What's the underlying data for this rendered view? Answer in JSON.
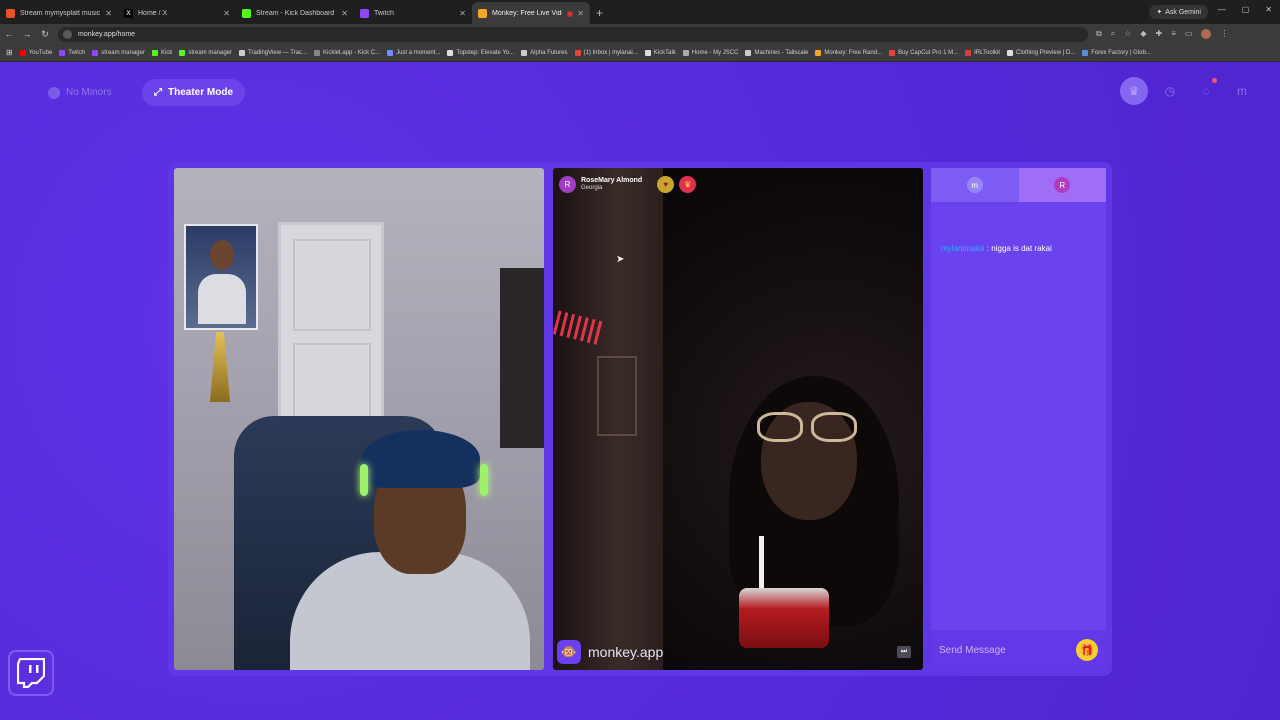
{
  "browser": {
    "tabs": [
      {
        "title": "Stream mymysplatt music | Lis",
        "color": "#e8522b"
      },
      {
        "title": "Home / X",
        "color": "#1f1f1f"
      },
      {
        "title": "Stream - Kick Dashboard",
        "color": "#53fc18"
      },
      {
        "title": "Twitch",
        "color": "#9146ff"
      },
      {
        "title": "Monkey: Free Live Video Ch",
        "color": "#f5a623"
      }
    ],
    "ask_label": "Ask Gemini",
    "url": "monkey.app/home",
    "bookmarks": [
      {
        "label": "YouTube",
        "color": "#ff0000"
      },
      {
        "label": "Twitch",
        "color": "#9146ff"
      },
      {
        "label": "stream manager",
        "color": "#9146ff"
      },
      {
        "label": "Kick",
        "color": "#53fc18"
      },
      {
        "label": "stream manager",
        "color": "#53fc18"
      },
      {
        "label": "TradingView — Trac...",
        "color": "#cccccc"
      },
      {
        "label": "Kicklet.app - Kick C...",
        "color": "#888888"
      },
      {
        "label": "Just a moment...",
        "color": "#6c8cff"
      },
      {
        "label": "Topstep: Elevate Yo...",
        "color": "#dddddd"
      },
      {
        "label": "Alpha Futures",
        "color": "#cccccc"
      },
      {
        "label": "(1) Inbox | mylanai...",
        "color": "#ea4335"
      },
      {
        "label": "KickTalk",
        "color": "#dddddd"
      },
      {
        "label": "Home - My JSCC",
        "color": "#aaaaaa"
      },
      {
        "label": "Machines - Tailscale",
        "color": "#cccccc"
      },
      {
        "label": "Monkey: Free Rand...",
        "color": "#f5a623"
      },
      {
        "label": "Buy CapCut Pro 1 M...",
        "color": "#ea4335"
      },
      {
        "label": "IRLToolkit",
        "color": "#e23b3b"
      },
      {
        "label": "Clothing Preview | D...",
        "color": "#dddddd"
      },
      {
        "label": "Forex Factory | Glob...",
        "color": "#5b8bd6"
      }
    ]
  },
  "header": {
    "no_minors": "No Minors",
    "theater_mode": "Theater Mode",
    "profile_initial": "m"
  },
  "remote": {
    "initial": "R",
    "name": "RoseMary Almond",
    "location": "Georgia",
    "brand": "monkey.app"
  },
  "chat": {
    "tab_me": "m",
    "tab_them": "R",
    "messages": [
      {
        "user": "mylanimakiii",
        "sep": ":",
        "text": "nigga is dat rakai"
      }
    ],
    "placeholder": "Send Message"
  }
}
